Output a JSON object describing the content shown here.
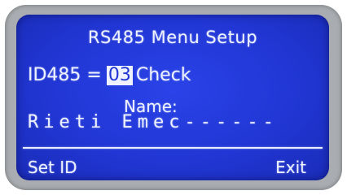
{
  "screen": {
    "title": "RS485 Menu Setup",
    "id_label": "ID485 =",
    "id_value": "03",
    "id_action": "Check",
    "name_label": "Name:",
    "name_value": "Rieti Emec------"
  },
  "softkeys": {
    "left": "Set ID",
    "right": "Exit"
  },
  "colors": {
    "lcd_background": "#2136d4",
    "lcd_text": "#eef2ff",
    "bezel": "#a9acb0"
  }
}
